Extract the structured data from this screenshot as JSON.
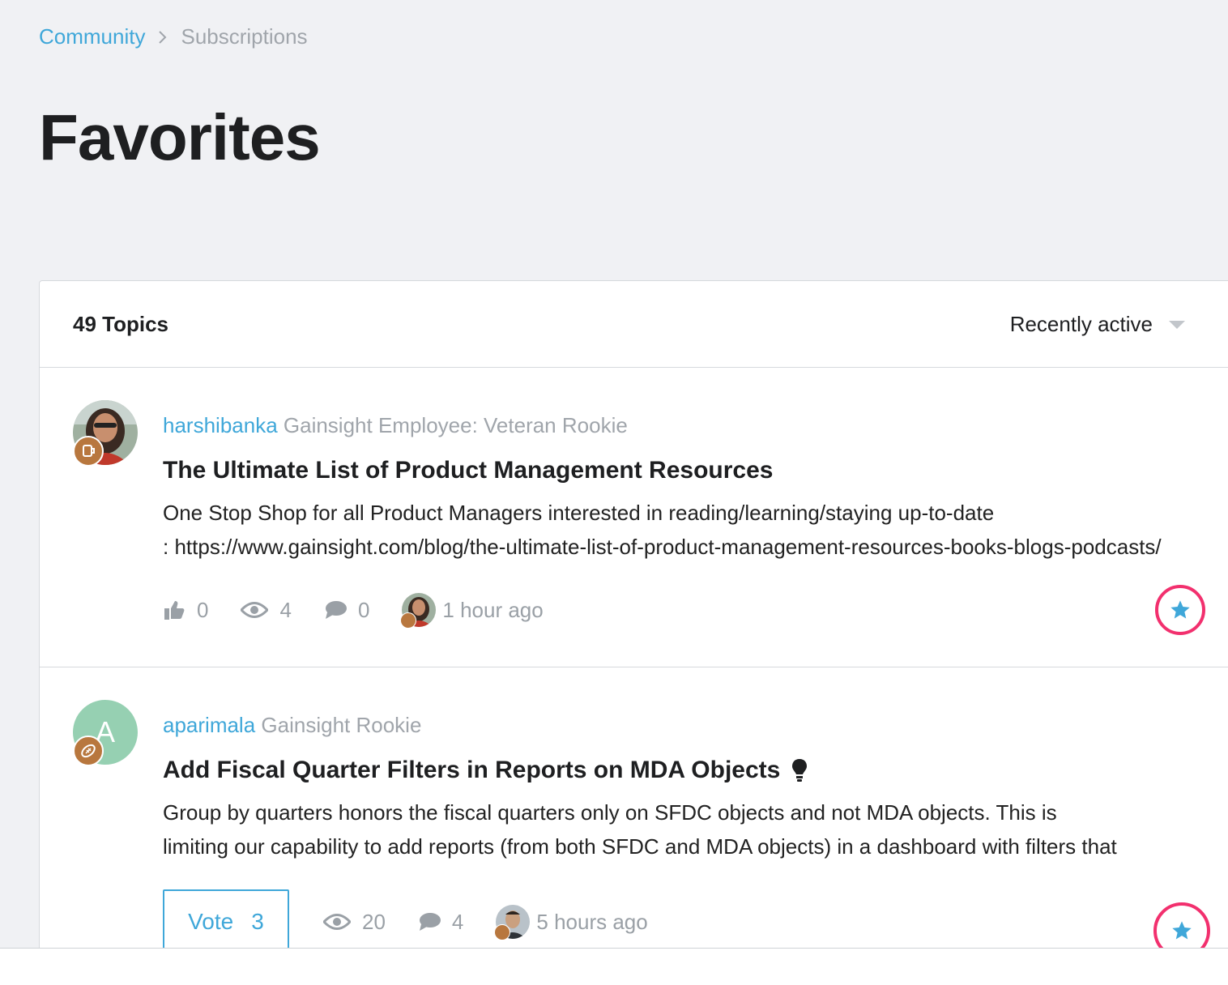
{
  "breadcrumb": {
    "root": "Community",
    "current": "Subscriptions"
  },
  "page": {
    "title": "Favorites"
  },
  "list": {
    "count_label": "49 Topics",
    "sort_selected": "Recently active"
  },
  "topics": [
    {
      "author": "harshibanka",
      "rank": "Gainsight Employee: Veteran Rookie",
      "title": "The Ultimate List of Product Management Resources",
      "excerpt_line1": "One Stop Shop for all Product Managers interested in reading/learning/staying up-to-date",
      "excerpt_line2": ": https://www.gainsight.com/blog/the-ultimate-list-of-product-management-resources-books-blogs-podcasts/",
      "likes": "0",
      "views": "4",
      "replies": "0",
      "last_activity": "1 hour ago"
    },
    {
      "author": "aparimala",
      "avatar_letter": "A",
      "rank": "Gainsight Rookie",
      "title": "Add Fiscal Quarter Filters in Reports on MDA Objects",
      "excerpt_line1": "Group by quarters honors the fiscal quarters only on SFDC objects and not MDA objects. This is",
      "excerpt_line2": "limiting our capability to add reports (from both SFDC and MDA objects) in a dashboard with filters that",
      "vote_label": "Vote",
      "votes": "3",
      "views": "20",
      "replies": "4",
      "last_activity": "5 hours ago"
    }
  ],
  "colors": {
    "accent": "#3fa7d9",
    "highlight": "#f2306e",
    "muted": "#a0a5ab",
    "badge": "#b8773e"
  }
}
